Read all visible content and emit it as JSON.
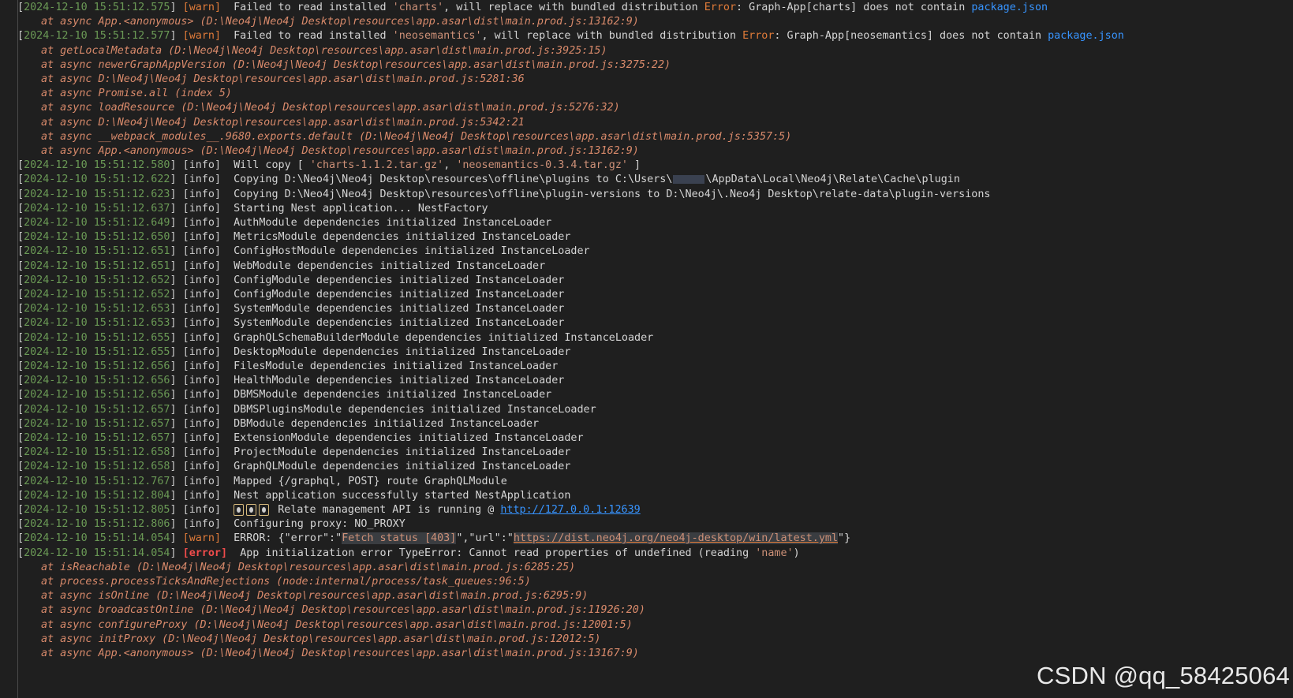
{
  "watermark": "CSDN @qq_58425064",
  "colors": {
    "background": "#1f1f1f",
    "timestamp": "#6a9955",
    "warn": "#e07b39",
    "error": "#f14c4c",
    "link": "#3794ff",
    "stack": "#d98a6b"
  },
  "lines": [
    {
      "kind": "log",
      "ts": "2024-12-10 15:51:12.575",
      "level": "warn",
      "msg": "Failed to read installed ",
      "q1": "'charts'",
      "msg2": ", will replace with bundled distribution ",
      "err": "Error",
      "msg3": ": Graph-App[charts] does not contain ",
      "link": "package.json"
    },
    {
      "kind": "stack",
      "text": "at async App.<anonymous> (D:\\Neo4j\\Neo4j Desktop\\resources\\app.asar\\dist\\main.prod.js:13162:9)"
    },
    {
      "kind": "log",
      "ts": "2024-12-10 15:51:12.577",
      "level": "warn",
      "msg": "Failed to read installed ",
      "q1": "'neosemantics'",
      "msg2": ", will replace with bundled distribution ",
      "err": "Error",
      "msg3": ": Graph-App[neosemantics] does not contain ",
      "link": "package.json"
    },
    {
      "kind": "stack",
      "text": "at getLocalMetadata (D:\\Neo4j\\Neo4j Desktop\\resources\\app.asar\\dist\\main.prod.js:3925:15)"
    },
    {
      "kind": "stack",
      "text": "at async newerGraphAppVersion (D:\\Neo4j\\Neo4j Desktop\\resources\\app.asar\\dist\\main.prod.js:3275:22)"
    },
    {
      "kind": "stack",
      "text": "at async D:\\Neo4j\\Neo4j Desktop\\resources\\app.asar\\dist\\main.prod.js:5281:36"
    },
    {
      "kind": "stack",
      "text": "at async Promise.all (index 5)"
    },
    {
      "kind": "stack",
      "text": "at async loadResource (D:\\Neo4j\\Neo4j Desktop\\resources\\app.asar\\dist\\main.prod.js:5276:32)"
    },
    {
      "kind": "stack",
      "text": "at async D:\\Neo4j\\Neo4j Desktop\\resources\\app.asar\\dist\\main.prod.js:5342:21"
    },
    {
      "kind": "stack",
      "text": "at async __webpack_modules__.9680.exports.default (D:\\Neo4j\\Neo4j Desktop\\resources\\app.asar\\dist\\main.prod.js:5357:5)"
    },
    {
      "kind": "stack",
      "text": "at async App.<anonymous> (D:\\Neo4j\\Neo4j Desktop\\resources\\app.asar\\dist\\main.prod.js:13162:9)"
    },
    {
      "kind": "log",
      "ts": "2024-12-10 15:51:12.580",
      "level": "info",
      "msg": "Will copy [ ",
      "q1": "'charts-1.1.2.tar.gz'",
      "msg2": ", ",
      "q2": "'neosemantics-0.3.4.tar.gz'",
      "msg3": " ]"
    },
    {
      "kind": "log",
      "ts": "2024-12-10 15:51:12.622",
      "level": "info",
      "msg": "Copying D:\\Neo4j\\Neo4j Desktop\\resources\\offline\\plugins to C:\\Users\\",
      "redact": true,
      "msg3": "\\AppData\\Local\\Neo4j\\Relate\\Cache\\plugin"
    },
    {
      "kind": "log",
      "ts": "2024-12-10 15:51:12.623",
      "level": "info",
      "msg": "Copying D:\\Neo4j\\Neo4j Desktop\\resources\\offline\\plugin-versions to D:\\Neo4j\\.Neo4j Desktop\\relate-data\\plugin-versions"
    },
    {
      "kind": "log",
      "ts": "2024-12-10 15:51:12.637",
      "level": "info",
      "msg": "Starting Nest application... NestFactory"
    },
    {
      "kind": "log",
      "ts": "2024-12-10 15:51:12.649",
      "level": "info",
      "msg": "AuthModule dependencies initialized InstanceLoader"
    },
    {
      "kind": "log",
      "ts": "2024-12-10 15:51:12.650",
      "level": "info",
      "msg": "MetricsModule dependencies initialized InstanceLoader"
    },
    {
      "kind": "log",
      "ts": "2024-12-10 15:51:12.651",
      "level": "info",
      "msg": "ConfigHostModule dependencies initialized InstanceLoader"
    },
    {
      "kind": "log",
      "ts": "2024-12-10 15:51:12.651",
      "level": "info",
      "msg": "WebModule dependencies initialized InstanceLoader"
    },
    {
      "kind": "log",
      "ts": "2024-12-10 15:51:12.652",
      "level": "info",
      "msg": "ConfigModule dependencies initialized InstanceLoader"
    },
    {
      "kind": "log",
      "ts": "2024-12-10 15:51:12.652",
      "level": "info",
      "msg": "ConfigModule dependencies initialized InstanceLoader"
    },
    {
      "kind": "log",
      "ts": "2024-12-10 15:51:12.653",
      "level": "info",
      "msg": "SystemModule dependencies initialized InstanceLoader"
    },
    {
      "kind": "log",
      "ts": "2024-12-10 15:51:12.653",
      "level": "info",
      "msg": "SystemModule dependencies initialized InstanceLoader"
    },
    {
      "kind": "log",
      "ts": "2024-12-10 15:51:12.655",
      "level": "info",
      "msg": "GraphQLSchemaBuilderModule dependencies initialized InstanceLoader"
    },
    {
      "kind": "log",
      "ts": "2024-12-10 15:51:12.655",
      "level": "info",
      "msg": "DesktopModule dependencies initialized InstanceLoader"
    },
    {
      "kind": "log",
      "ts": "2024-12-10 15:51:12.656",
      "level": "info",
      "msg": "FilesModule dependencies initialized InstanceLoader"
    },
    {
      "kind": "log",
      "ts": "2024-12-10 15:51:12.656",
      "level": "info",
      "msg": "HealthModule dependencies initialized InstanceLoader"
    },
    {
      "kind": "log",
      "ts": "2024-12-10 15:51:12.656",
      "level": "info",
      "msg": "DBMSModule dependencies initialized InstanceLoader"
    },
    {
      "kind": "log",
      "ts": "2024-12-10 15:51:12.657",
      "level": "info",
      "msg": "DBMSPluginsModule dependencies initialized InstanceLoader"
    },
    {
      "kind": "log",
      "ts": "2024-12-10 15:51:12.657",
      "level": "info",
      "msg": "DBModule dependencies initialized InstanceLoader"
    },
    {
      "kind": "log",
      "ts": "2024-12-10 15:51:12.657",
      "level": "info",
      "msg": "ExtensionModule dependencies initialized InstanceLoader"
    },
    {
      "kind": "log",
      "ts": "2024-12-10 15:51:12.658",
      "level": "info",
      "msg": "ProjectModule dependencies initialized InstanceLoader"
    },
    {
      "kind": "log",
      "ts": "2024-12-10 15:51:12.658",
      "level": "info",
      "msg": "GraphQLModule dependencies initialized InstanceLoader"
    },
    {
      "kind": "log",
      "ts": "2024-12-10 15:51:12.767",
      "level": "info",
      "msg": "Mapped {/graphql, POST} route GraphQLModule"
    },
    {
      "kind": "log",
      "ts": "2024-12-10 15:51:12.804",
      "level": "info",
      "msg": "Nest application successfully started NestApplication"
    },
    {
      "kind": "log",
      "ts": "2024-12-10 15:51:12.805",
      "level": "info",
      "emoji": true,
      "msg": "Relate management API is running @ ",
      "url": "http://127.0.0.1:12639"
    },
    {
      "kind": "log",
      "ts": "2024-12-10 15:51:12.806",
      "level": "info",
      "msg": "Configuring proxy: NO_PROXY"
    },
    {
      "kind": "log",
      "ts": "2024-12-10 15:51:14.054",
      "level": "warn",
      "msg": "ERROR: {\"error\":\"",
      "hl": "Fetch status [403]",
      "msg2": "\",\"url\":\"",
      "hlurl": "https://dist.neo4j.org/neo4j-desktop/win/latest.yml",
      "msg3": "\"}"
    },
    {
      "kind": "log",
      "ts": "2024-12-10 15:51:14.054",
      "level": "error",
      "msg": "App initialization error TypeError: Cannot read properties of undefined (reading ",
      "q1": "'name'",
      "msg2": ")"
    },
    {
      "kind": "stack",
      "text": "at isReachable (D:\\Neo4j\\Neo4j Desktop\\resources\\app.asar\\dist\\main.prod.js:6285:25)"
    },
    {
      "kind": "stack",
      "text": "at process.processTicksAndRejections (node:internal/process/task_queues:96:5)"
    },
    {
      "kind": "stack",
      "text": "at async isOnline (D:\\Neo4j\\Neo4j Desktop\\resources\\app.asar\\dist\\main.prod.js:6295:9)"
    },
    {
      "kind": "stack",
      "text": "at async broadcastOnline (D:\\Neo4j\\Neo4j Desktop\\resources\\app.asar\\dist\\main.prod.js:11926:20)"
    },
    {
      "kind": "stack",
      "text": "at async configureProxy (D:\\Neo4j\\Neo4j Desktop\\resources\\app.asar\\dist\\main.prod.js:12001:5)"
    },
    {
      "kind": "stack",
      "text": "at async initProxy (D:\\Neo4j\\Neo4j Desktop\\resources\\app.asar\\dist\\main.prod.js:12012:5)"
    },
    {
      "kind": "stack",
      "text": "at async App.<anonymous> (D:\\Neo4j\\Neo4j Desktop\\resources\\app.asar\\dist\\main.prod.js:13167:9)"
    }
  ]
}
